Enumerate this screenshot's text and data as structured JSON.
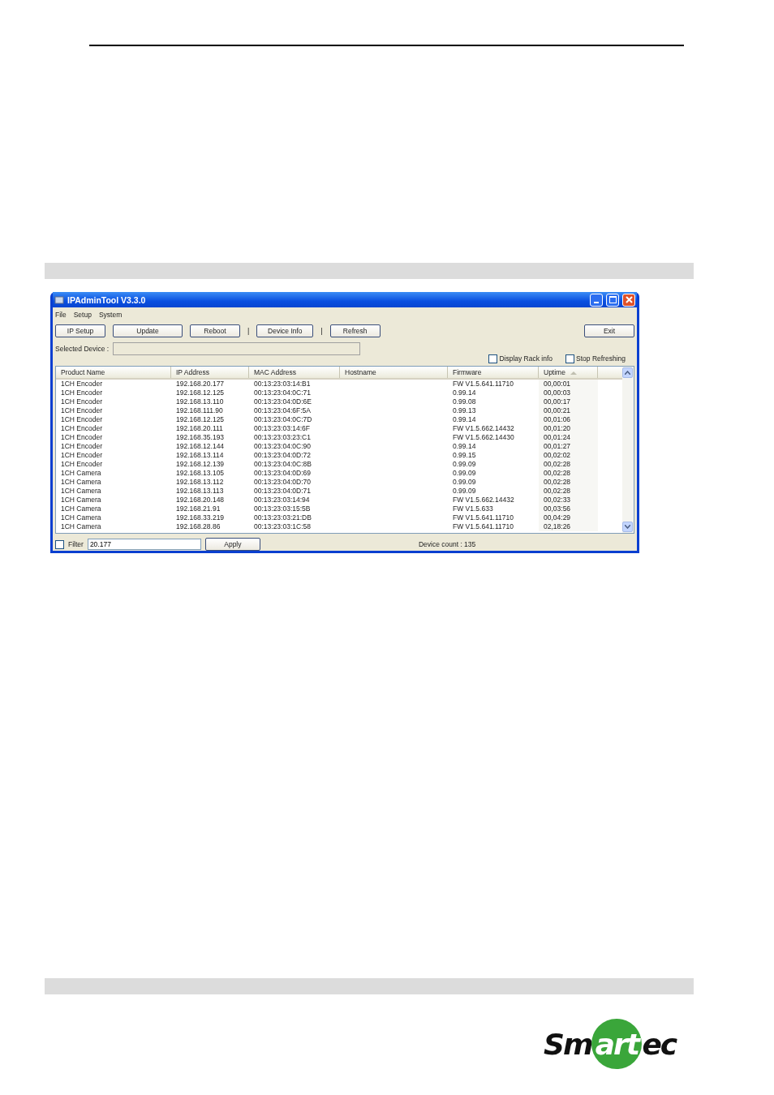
{
  "window": {
    "title": "IPAdminTool V3.3.0"
  },
  "menu": [
    "File",
    "Setup",
    "System"
  ],
  "toolbar": [
    {
      "kind": "button",
      "label": "IP Setup"
    },
    {
      "kind": "button",
      "label": "Update"
    },
    {
      "kind": "button",
      "label": "Reboot"
    },
    {
      "kind": "separator",
      "label": "|"
    },
    {
      "kind": "button",
      "label": "Device Info"
    },
    {
      "kind": "separator",
      "label": "|"
    },
    {
      "kind": "button",
      "label": "Refresh"
    },
    {
      "kind": "spacer"
    },
    {
      "kind": "button",
      "label": "Exit"
    }
  ],
  "selected_device": {
    "label": "Selected Device :"
  },
  "options": [
    {
      "label": "Display Rack info",
      "checked": false
    },
    {
      "label": "Stop Refreshing",
      "checked": false
    }
  ],
  "table": {
    "columns": [
      {
        "label": "Product Name",
        "sorted": false
      },
      {
        "label": "IP Address",
        "sorted": false
      },
      {
        "label": "MAC Address",
        "sorted": false
      },
      {
        "label": "Hostname",
        "sorted": false
      },
      {
        "label": "Firmware",
        "sorted": false
      },
      {
        "label": "Uptime",
        "sorted": true
      }
    ],
    "rows": [
      [
        "1CH Encoder",
        "192.168.20.177",
        "00:13:23:03:14:B1",
        "",
        "FW V1.5.641.11710",
        "00,00:01"
      ],
      [
        "1CH Encoder",
        "192.168.12.125",
        "00:13:23:04:0C:71",
        "",
        "0.99.14",
        "00,00:03"
      ],
      [
        "1CH Encoder",
        "192.168.13.110",
        "00:13:23:04:0D:6E",
        "",
        "0.99.08",
        "00,00:17"
      ],
      [
        "1CH Encoder",
        "192.168.111.90",
        "00:13:23:04:6F:5A",
        "",
        "0.99.13",
        "00,00:21"
      ],
      [
        "1CH Encoder",
        "192.168.12.125",
        "00:13:23:04:0C:7D",
        "",
        "0.99.14",
        "00,01:06"
      ],
      [
        "1CH Encoder",
        "192.168.20.111",
        "00:13:23:03:14:6F",
        "",
        "FW V1.5.662.14432",
        "00,01:20"
      ],
      [
        "1CH Encoder",
        "192.168.35.193",
        "00:13:23:03:23:C1",
        "",
        "FW V1.5.662.14430",
        "00,01:24"
      ],
      [
        "1CH Encoder",
        "192.168.12.144",
        "00:13:23:04:0C:90",
        "",
        "0.99.14",
        "00,01:27"
      ],
      [
        "1CH Encoder",
        "192.168.13.114",
        "00:13:23:04:0D:72",
        "",
        "0.99.15",
        "00,02:02"
      ],
      [
        "1CH Encoder",
        "192.168.12.139",
        "00:13:23:04:0C:8B",
        "",
        "0.99.09",
        "00,02:28"
      ],
      [
        "1CH Camera",
        "192.168.13.105",
        "00:13:23:04:0D:69",
        "",
        "0.99.09",
        "00,02:28"
      ],
      [
        "1CH Camera",
        "192.168.13.112",
        "00:13:23:04:0D:70",
        "",
        "0.99.09",
        "00,02:28"
      ],
      [
        "1CH Camera",
        "192.168.13.113",
        "00:13:23:04:0D:71",
        "",
        "0.99.09",
        "00,02:28"
      ],
      [
        "1CH Camera",
        "192.168.20.148",
        "00:13:23:03:14:94",
        "",
        "FW V1.5.662.14432",
        "00,02:33"
      ],
      [
        "1CH Camera",
        "192.168.21.91",
        "00:13:23:03:15:5B",
        "",
        "FW V1.5.633",
        "00,03:56"
      ],
      [
        "1CH Camera",
        "192.168.33.219",
        "00:13:23:03:21:DB",
        "",
        "FW V1.5.641.11710",
        "00,04:29"
      ],
      [
        "1CH Camera",
        "192.168.28.86",
        "00:13:23:03:1C:58",
        "",
        "FW V1.5.641.11710",
        "02,18:26"
      ]
    ]
  },
  "filter": {
    "label": "Filter",
    "checked": false,
    "value": "20.177",
    "button": "Apply"
  },
  "status": "Device count : 135",
  "logo": {
    "before": "Sm",
    "highlight": "art",
    "after": "ec"
  }
}
